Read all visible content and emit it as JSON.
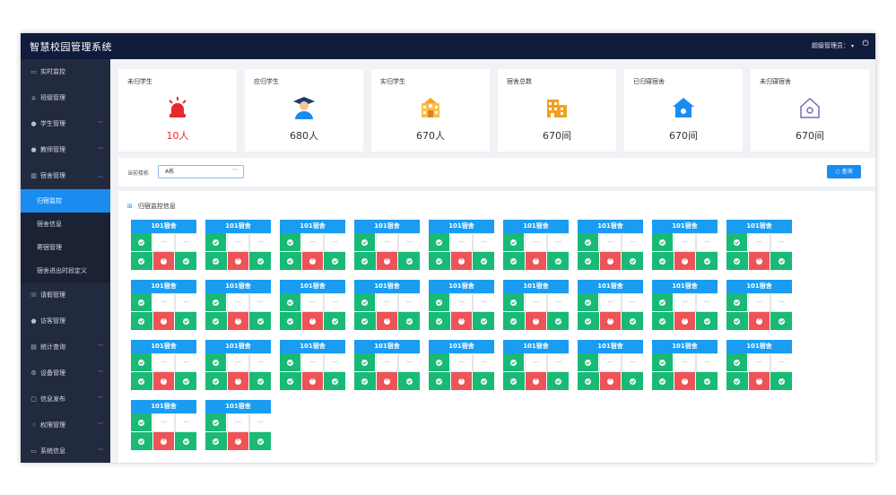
{
  "app": {
    "title": "智慧校园管理系统",
    "user_label": "超级管理员：",
    "user_caret": "▾"
  },
  "sidebar": {
    "items": [
      {
        "label": "实时监控",
        "icon": "monitor-icon",
        "arrow": ""
      },
      {
        "label": "班级管理",
        "icon": "home-icon",
        "arrow": ""
      },
      {
        "label": "学生管理",
        "icon": "user-icon",
        "arrow": "﹀"
      },
      {
        "label": "教师管理",
        "icon": "user-icon",
        "arrow": "﹀"
      },
      {
        "label": "宿舍管理",
        "icon": "building-icon",
        "arrow": "︿"
      }
    ],
    "sub_items": [
      {
        "label": "归宿监控",
        "active": true
      },
      {
        "label": "宿舍信息",
        "active": false
      },
      {
        "label": "寄宿管理",
        "active": false
      },
      {
        "label": "宿舍进出时段定义",
        "active": false
      }
    ],
    "items_after": [
      {
        "label": "请假管理",
        "icon": "phone-icon",
        "arrow": ""
      },
      {
        "label": "访客管理",
        "icon": "user-icon",
        "arrow": ""
      },
      {
        "label": "统计查询",
        "icon": "chart-icon",
        "arrow": "﹀"
      },
      {
        "label": "设备管理",
        "icon": "gear-icon",
        "arrow": "﹀"
      },
      {
        "label": "信息发布",
        "icon": "message-icon",
        "arrow": "﹀"
      },
      {
        "label": "权限管理",
        "icon": "hand-icon",
        "arrow": "﹀"
      },
      {
        "label": "系统信息",
        "icon": "screen-icon",
        "arrow": "﹀"
      }
    ]
  },
  "stats": [
    {
      "label": "未归学生",
      "value": "10人",
      "icon": "alarm-icon",
      "color": "#e6282f"
    },
    {
      "label": "应归学生",
      "value": "680人",
      "icon": "graduate-icon",
      "color": "#333333"
    },
    {
      "label": "实归学生",
      "value": "670人",
      "icon": "school-icon",
      "color": "#333333"
    },
    {
      "label": "宿舍总数",
      "value": "670间",
      "icon": "building-icon",
      "color": "#333333"
    },
    {
      "label": "已归寝宿舍",
      "value": "670间",
      "icon": "house-filled-icon",
      "color": "#333333"
    },
    {
      "label": "未归寝宿舍",
      "value": "670间",
      "icon": "house-outline-icon",
      "color": "#333333"
    }
  ],
  "filter": {
    "label": "当前楼栋",
    "selected": "A栋",
    "query_label": "查询"
  },
  "panel": {
    "title": "归宿监控信息"
  },
  "dorm_cell_placeholder": "---",
  "dorms": [
    "101宿舍",
    "101宿舍",
    "101宿舍",
    "101宿舍",
    "101宿舍",
    "101宿舍",
    "101宿舍",
    "101宿舍",
    "101宿舍",
    "101宿舍",
    "101宿舍",
    "101宿舍",
    "101宿舍",
    "101宿舍",
    "101宿舍",
    "101宿舍",
    "101宿舍",
    "101宿舍",
    "101宿舍",
    "101宿舍",
    "101宿舍",
    "101宿舍",
    "101宿舍",
    "101宿舍",
    "101宿舍",
    "101宿舍",
    "101宿舍",
    "101宿舍",
    "101宿舍"
  ],
  "colors": {
    "accent": "#1a8cf0",
    "present": "#19b976",
    "absent": "#ee5357",
    "header": "#1a9cf0",
    "topbar": "#101c3b",
    "sidebar": "#222a3f"
  }
}
